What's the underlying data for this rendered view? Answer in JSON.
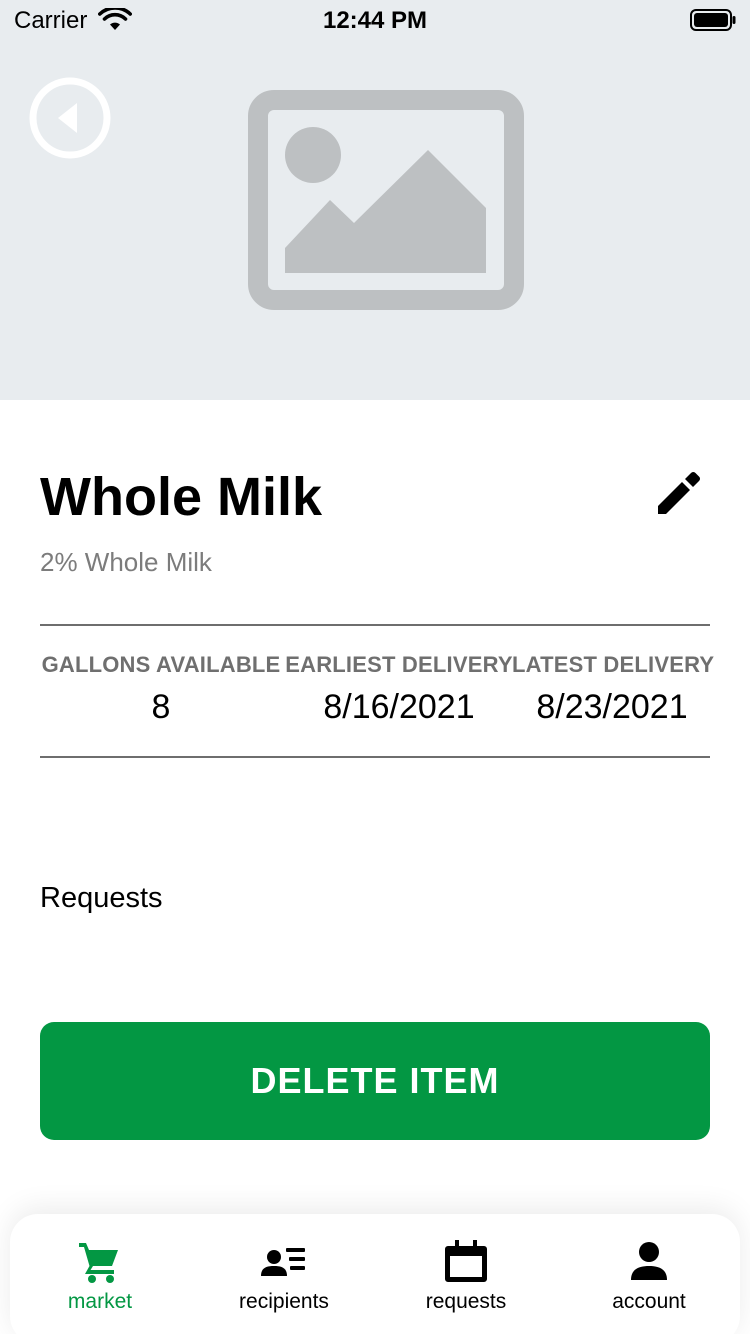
{
  "status_bar": {
    "carrier": "Carrier",
    "time": "12:44 PM"
  },
  "item": {
    "title": "Whole Milk",
    "description": "2% Whole Milk",
    "stats": [
      {
        "label": "GALLONS AVAILABLE",
        "value": "8"
      },
      {
        "label": "EARLIEST DELIVERY",
        "value": "8/16/2021"
      },
      {
        "label": "LATEST DELIVERY",
        "value": "8/23/2021"
      }
    ]
  },
  "requests_label": "Requests",
  "delete_button_label": "DELETE ITEM",
  "tabs": [
    {
      "label": "market",
      "icon": "cart-icon",
      "active": true
    },
    {
      "label": "recipients",
      "icon": "recipients-icon",
      "active": false
    },
    {
      "label": "requests",
      "icon": "calendar-icon",
      "active": false
    },
    {
      "label": "account",
      "icon": "person-icon",
      "active": false
    }
  ],
  "colors": {
    "accent": "#039743",
    "hero_bg": "#e8ecef",
    "placeholder": "#bdc0c2",
    "muted_text": "#7c7c7c"
  }
}
